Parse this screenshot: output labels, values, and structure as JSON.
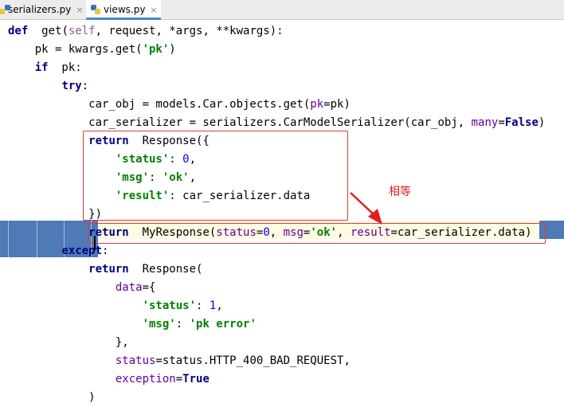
{
  "tabs": [
    {
      "label": "serializers.py",
      "icon": "python-file-icon",
      "active": false
    },
    {
      "label": "views.py",
      "icon": "python-file-icon",
      "active": true
    }
  ],
  "close_glyph": "×",
  "annotation": "相等",
  "code_lines": [
    [
      [
        "kw",
        "def"
      ],
      [
        "",
        "  get("
      ],
      [
        "self",
        "self"
      ],
      [
        "",
        ", request, *args, **kwargs):"
      ]
    ],
    [
      [
        "",
        "    pk = kwargs.get("
      ],
      [
        "str",
        "'pk'"
      ],
      [
        "",
        ")"
      ]
    ],
    [
      [
        "",
        "    "
      ],
      [
        "kw",
        "if"
      ],
      [
        "",
        "  pk:"
      ]
    ],
    [
      [
        "",
        "        "
      ],
      [
        "kw",
        "try"
      ],
      [
        "",
        ":"
      ]
    ],
    [
      [
        "",
        "            car_obj = models.Car.objects.get("
      ],
      [
        "param",
        "pk"
      ],
      [
        "",
        "=pk)"
      ]
    ],
    [
      [
        "",
        "            car_serializer = serializers.CarModelSerializer(car_obj, "
      ],
      [
        "param",
        "many"
      ],
      [
        "",
        "="
      ],
      [
        "kw",
        "False"
      ],
      [
        "",
        ")"
      ]
    ],
    [
      [
        "",
        "            "
      ],
      [
        "kw",
        "return"
      ],
      [
        "",
        "  Response({"
      ]
    ],
    [
      [
        "",
        "                "
      ],
      [
        "str",
        "'status'"
      ],
      [
        "",
        ": "
      ],
      [
        "num",
        "0"
      ],
      [
        "",
        ","
      ]
    ],
    [
      [
        "",
        "                "
      ],
      [
        "str",
        "'msg'"
      ],
      [
        "",
        ": "
      ],
      [
        "str",
        "'ok'"
      ],
      [
        "",
        ","
      ]
    ],
    [
      [
        "",
        "                "
      ],
      [
        "str",
        "'result'"
      ],
      [
        "",
        ": car_serializer.data"
      ]
    ],
    [
      [
        "",
        "            })"
      ]
    ],
    [
      [
        "",
        "            "
      ],
      [
        "kw",
        "return"
      ],
      [
        "",
        "  MyResponse("
      ],
      [
        "param",
        "status"
      ],
      [
        "",
        "="
      ],
      [
        "num",
        "0"
      ],
      [
        "",
        ", "
      ],
      [
        "param",
        "msg"
      ],
      [
        "",
        "="
      ],
      [
        "str",
        "'ok'"
      ],
      [
        "",
        ", "
      ],
      [
        "param",
        "result"
      ],
      [
        "",
        "=car_serializer.data)"
      ]
    ],
    [
      [
        "",
        "        "
      ],
      [
        "kw",
        "except"
      ],
      [
        "",
        ":"
      ]
    ],
    [
      [
        "",
        "            "
      ],
      [
        "kw",
        "return"
      ],
      [
        "",
        "  Response("
      ]
    ],
    [
      [
        "",
        "                "
      ],
      [
        "param",
        "data"
      ],
      [
        "",
        "={"
      ]
    ],
    [
      [
        "",
        "                    "
      ],
      [
        "str",
        "'status'"
      ],
      [
        "",
        ": "
      ],
      [
        "num",
        "1"
      ],
      [
        "",
        ","
      ]
    ],
    [
      [
        "",
        "                    "
      ],
      [
        "str",
        "'msg'"
      ],
      [
        "",
        ": "
      ],
      [
        "str",
        "'pk error'"
      ]
    ],
    [
      [
        "",
        "                },"
      ]
    ],
    [
      [
        "",
        "                "
      ],
      [
        "param",
        "status"
      ],
      [
        "",
        "=status.HTTP_400_BAD_REQUEST,"
      ]
    ],
    [
      [
        "",
        "                "
      ],
      [
        "param",
        "exception"
      ],
      [
        "",
        "="
      ],
      [
        "kw",
        "True"
      ]
    ],
    [
      [
        "",
        "            )"
      ]
    ]
  ],
  "colors": {
    "keyword": "#000080",
    "string": "#008000",
    "number": "#0000ff",
    "param": "#660099",
    "self": "#94558d",
    "annotation": "#e02020"
  }
}
